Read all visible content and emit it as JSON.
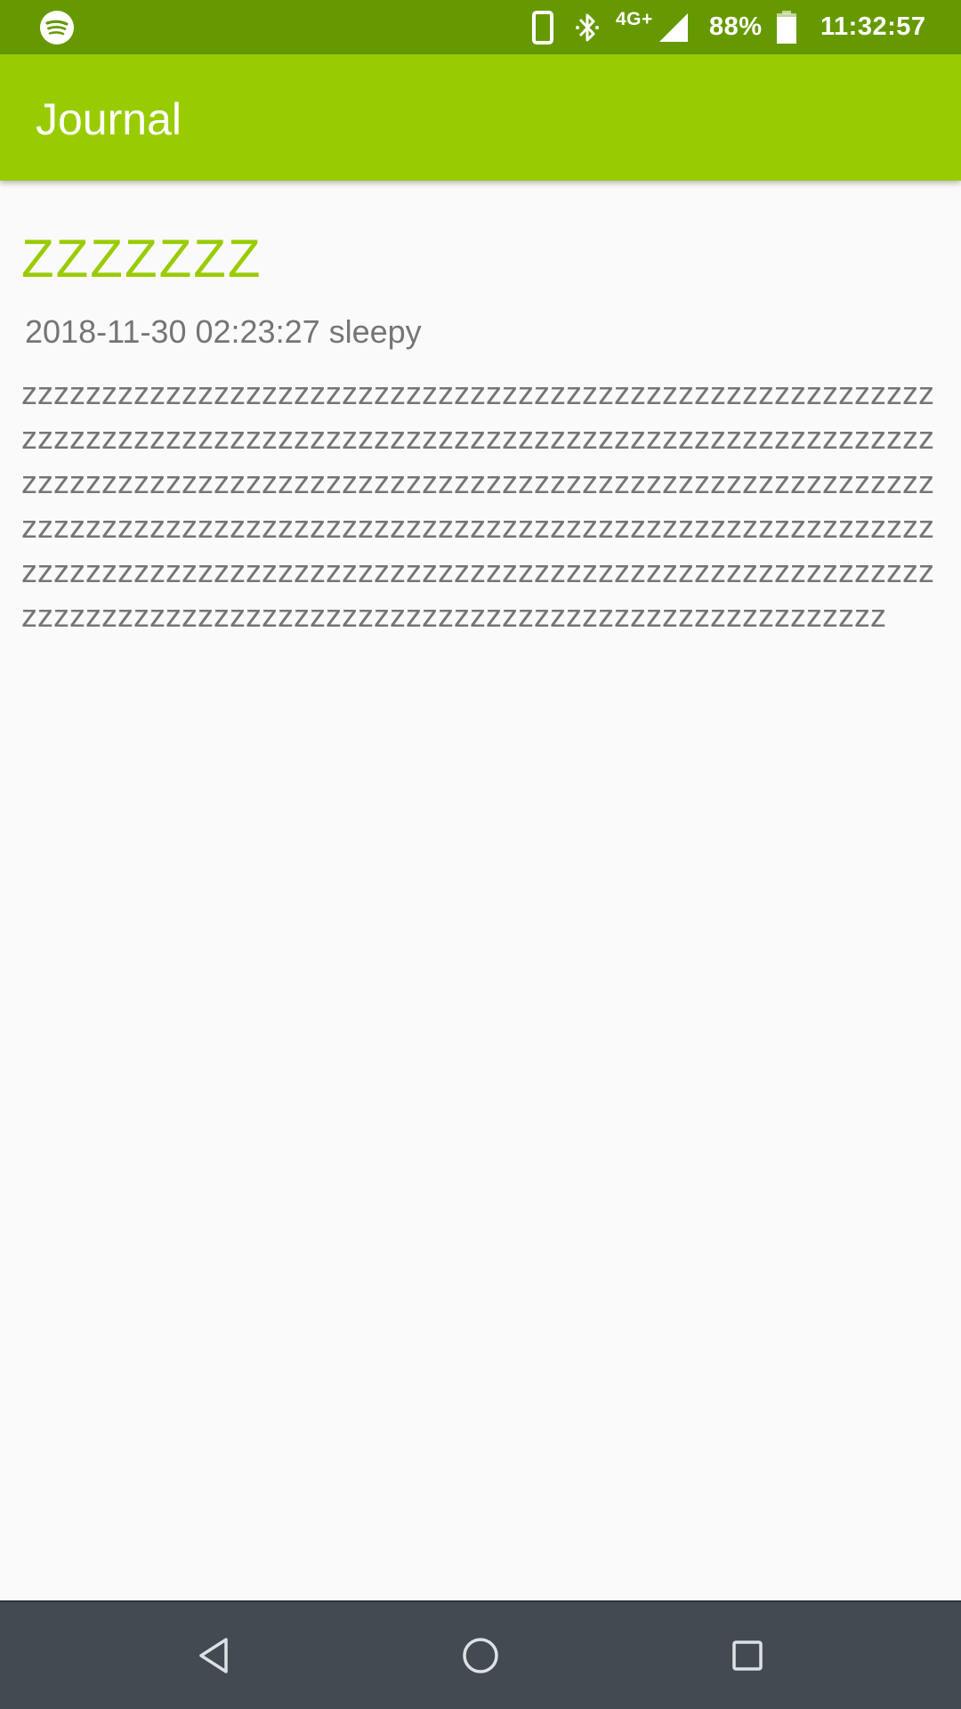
{
  "status_bar": {
    "app_icon": "spotify-icon",
    "icons": [
      "phone-vibrate-icon",
      "bluetooth-icon",
      "signal-icon",
      "battery-icon"
    ],
    "network": "4G+",
    "battery": "88%",
    "time": "11:32:57",
    "background": "#669900"
  },
  "app_bar": {
    "title": "Journal",
    "background": "#99cc00"
  },
  "entry": {
    "title": "ZZZZZZZ",
    "meta": "2018-11-30 02:23:27 sleepy",
    "body": "zzzzzzzzzzzzzzzzzzzzzzzzzzzzzzzzzzzzzzzzzzzzzzzzzzzzzzzzzzzzzzzzzzzzzzzzzzzzzzzzzzzzzzzzzzzzzzzzzzzzzzzzzzzzzzzzzzzzzzzzzzzzzzzzzzzzzzzzzzzzzzzzzzzzzzzzzzzzzzzzzzzzzzzzzzzzzzzzzzzzzzzzzzzzzzzzzzzzzzzzzzzzzzzzzzzzzzzzzzzzzzzzzzzzzzzzzzzzzzzzzzzzzzzzzzzzzzzzzzzzzzzzzzzzzzzzzzzzzzzzzzzzzzzzzzzzzzzzzzzzzzzzzzzzzzzzzzzzzzzzzzzzzzzzzzzzzzzzzzz",
    "title_color": "#99cc00",
    "text_color": "#757575"
  },
  "nav_bar": {
    "buttons": [
      "back-icon",
      "home-icon",
      "recents-icon"
    ],
    "background": "#434a52"
  }
}
